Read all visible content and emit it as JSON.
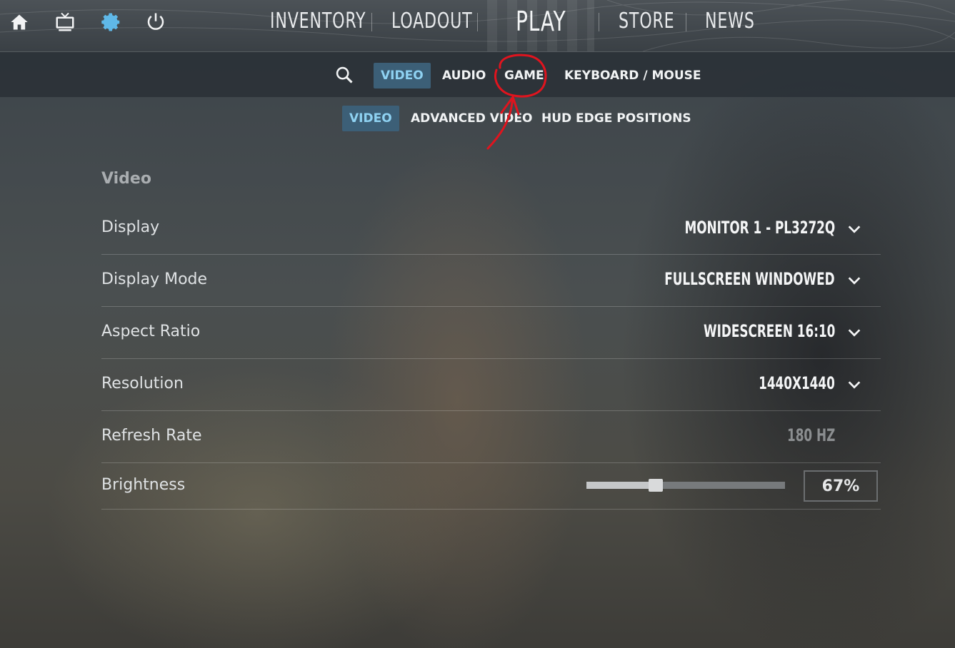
{
  "topnav": {
    "icons": [
      "home-icon",
      "tv-icon",
      "gear-icon",
      "power-icon"
    ],
    "items": [
      "INVENTORY",
      "LOADOUT",
      "PLAY",
      "STORE",
      "NEWS"
    ]
  },
  "settings_tabs": [
    "VIDEO",
    "AUDIO",
    "GAME",
    "KEYBOARD / MOUSE"
  ],
  "active_settings_tab": "VIDEO",
  "video_subtabs": [
    "VIDEO",
    "ADVANCED VIDEO",
    "HUD EDGE POSITIONS"
  ],
  "active_subtab": "VIDEO",
  "section": {
    "title": "Video"
  },
  "rows": [
    {
      "label": "Display",
      "value": "MONITOR 1 - PL3272Q"
    },
    {
      "label": "Display Mode",
      "value": "FULLSCREEN WINDOWED"
    },
    {
      "label": "Aspect Ratio",
      "value": "WIDESCREEN 16:10"
    },
    {
      "label": "Resolution",
      "value": "1440X1440"
    },
    {
      "label": "Refresh Rate",
      "value": "180 HZ"
    }
  ],
  "brightness": {
    "label": "Brightness",
    "value": 0.67,
    "display": "67%"
  },
  "colors": {
    "accent_tab_bg": "#3c5f77",
    "accent_tab_text": "#8fd2f2",
    "settings_icon": "#5fb8e8",
    "annotation_red": "#e0141e"
  }
}
